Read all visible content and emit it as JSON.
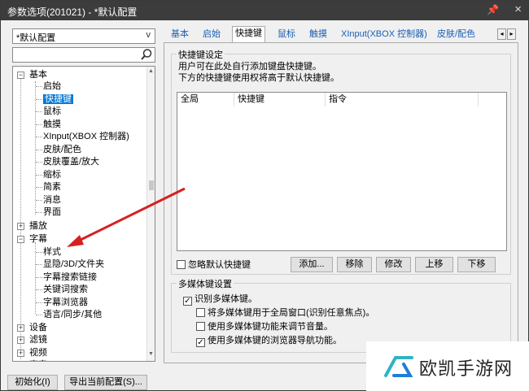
{
  "window": {
    "title": "参数选项(201021) - *默认配置",
    "pin": "📌",
    "close": "×"
  },
  "left": {
    "preset_value": "*默认配置",
    "preset_arrow": "v",
    "search_value": "",
    "tree": [
      "基本",
      "启始",
      "快捷键",
      "鼠标",
      "触摸",
      "XInput(XBOX 控制器)",
      "皮肤/配色",
      "皮肤覆盖/放大",
      "缩标",
      "简素",
      "消息",
      "界面",
      "播放",
      "字幕",
      "样式",
      "显隐/3D/文件夹",
      "字幕搜索链接",
      "关键词搜索",
      "字幕浏览器",
      "语言/同步/其他",
      "设备",
      "滤镜",
      "视频",
      "声音"
    ],
    "init_button": "初始化(I)",
    "export_button": "导出当前配置(S)..."
  },
  "tabs": [
    "基本",
    "启始",
    "快捷键",
    "鼠标",
    "触摸",
    "XInput(XBOX 控制器)",
    "皮肤/配色"
  ],
  "tab_scroll_left": "◂",
  "tab_scroll_right": "▸",
  "hotkey_group": {
    "legend": "快捷键设定",
    "desc1": "用户可在此处自行添加键盘快捷键。",
    "desc2": "下方的快捷键使用权将高于默认快捷键。",
    "columns": [
      "全局",
      "快捷键",
      "指令"
    ],
    "ignore_default": "忽略默认快捷键",
    "ignore_default_checked": false,
    "buttons": [
      "添加...",
      "移除",
      "修改",
      "上移",
      "下移"
    ]
  },
  "media_group": {
    "legend": "多媒体键设置",
    "options": [
      {
        "label": "识别多媒体键。",
        "checked": true
      },
      {
        "label": "将多媒体键用于全局窗口(识别任意焦点)。",
        "checked": false
      },
      {
        "label": "使用多媒体键功能来调节音量。",
        "checked": false
      },
      {
        "label": "使用多媒体键的浏览器导航功能。",
        "checked": true
      }
    ]
  },
  "watermark": {
    "text": "欧凯手游网"
  },
  "colors": {
    "selection": "#0078d7",
    "annotation_arrow": "#d62020",
    "titlebar": "#3c3c3c"
  }
}
